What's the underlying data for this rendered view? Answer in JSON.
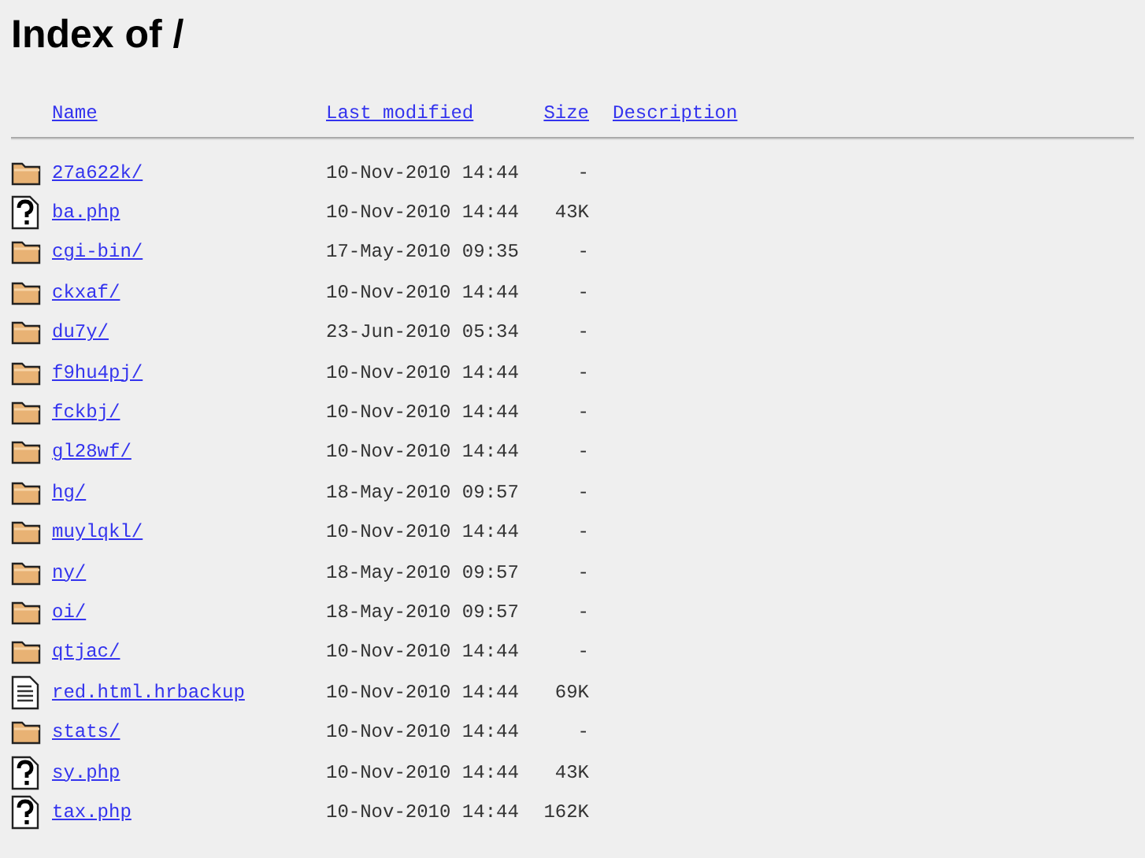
{
  "title": "Index of /",
  "columns": [
    "Name",
    "Last modified",
    "Size",
    "Description"
  ],
  "rows": [
    {
      "kind": "folder",
      "name": "27a622k/",
      "modified": "10-Nov-2010 14:44",
      "size": "-"
    },
    {
      "kind": "unknown",
      "name": "ba.php",
      "modified": "10-Nov-2010 14:44",
      "size": "43K"
    },
    {
      "kind": "folder",
      "name": "cgi-bin/",
      "modified": "17-May-2010 09:35",
      "size": "-"
    },
    {
      "kind": "folder",
      "name": "ckxaf/",
      "modified": "10-Nov-2010 14:44",
      "size": "-"
    },
    {
      "kind": "folder",
      "name": "du7y/",
      "modified": "23-Jun-2010 05:34",
      "size": "-"
    },
    {
      "kind": "folder",
      "name": "f9hu4pj/",
      "modified": "10-Nov-2010 14:44",
      "size": "-"
    },
    {
      "kind": "folder",
      "name": "fckbj/",
      "modified": "10-Nov-2010 14:44",
      "size": "-"
    },
    {
      "kind": "folder",
      "name": "gl28wf/",
      "modified": "10-Nov-2010 14:44",
      "size": "-"
    },
    {
      "kind": "folder",
      "name": "hg/",
      "modified": "18-May-2010 09:57",
      "size": "-"
    },
    {
      "kind": "folder",
      "name": "muylqkl/",
      "modified": "10-Nov-2010 14:44",
      "size": "-"
    },
    {
      "kind": "folder",
      "name": "ny/",
      "modified": "18-May-2010 09:57",
      "size": "-"
    },
    {
      "kind": "folder",
      "name": "oi/",
      "modified": "18-May-2010 09:57",
      "size": "-"
    },
    {
      "kind": "folder",
      "name": "qtjac/",
      "modified": "10-Nov-2010 14:44",
      "size": "-"
    },
    {
      "kind": "text",
      "name": "red.html.hrbackup",
      "modified": "10-Nov-2010 14:44",
      "size": "69K"
    },
    {
      "kind": "folder",
      "name": "stats/",
      "modified": "10-Nov-2010 14:44",
      "size": "-"
    },
    {
      "kind": "unknown",
      "name": "sy.php",
      "modified": "10-Nov-2010 14:44",
      "size": "43K"
    },
    {
      "kind": "unknown",
      "name": "tax.php",
      "modified": "10-Nov-2010 14:44",
      "size": "162K"
    }
  ]
}
